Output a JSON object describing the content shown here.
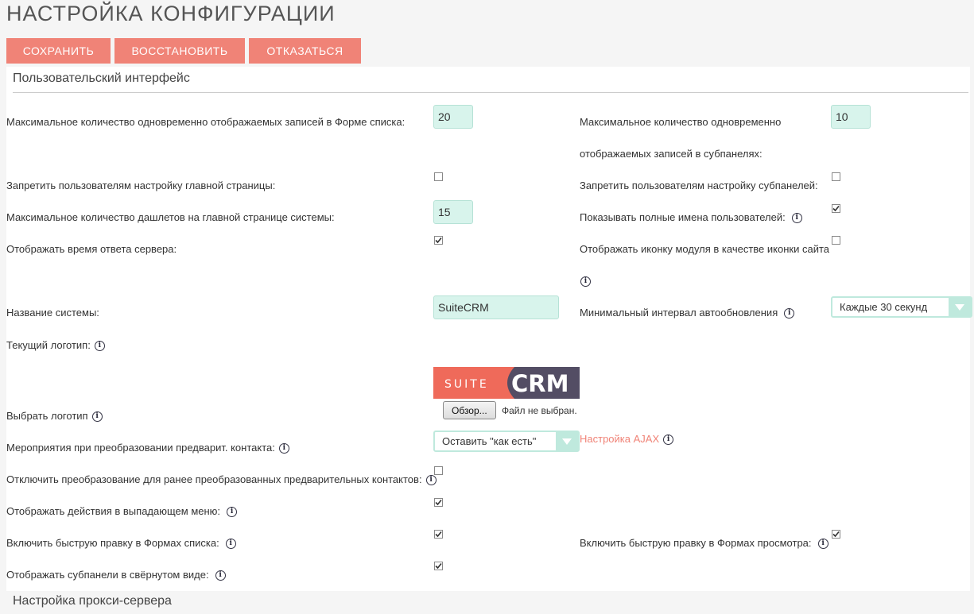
{
  "page": {
    "title": "НАСТРОЙКА КОНФИГУРАЦИИ"
  },
  "toolbar": {
    "save": "СОХРАНИТЬ",
    "restore": "ВОССТАНОВИТЬ",
    "cancel": "ОТКАЗАТЬСЯ"
  },
  "sections": {
    "ui": "Пользовательский интерфейс",
    "proxy": "Настройка прокси-сервера"
  },
  "fields": {
    "list_max": {
      "label": "Максимальное количество одновременно отображаемых записей в Форме списка:",
      "value": "20"
    },
    "subpanel_max": {
      "label1": "Максимальное количество одновременно",
      "label2": "отображаемых записей в субпанелях:",
      "value": "10"
    },
    "lock_home": {
      "label": "Запретить пользователям настройку главной страницы:",
      "checked": false
    },
    "lock_subpanels": {
      "label": "Запретить пользователям настройку субпанелей:",
      "checked": false
    },
    "dashlets_max": {
      "label": "Максимальное количество дашлетов на главной странице системы:",
      "value": "15"
    },
    "full_names": {
      "label": "Показывать полные имена пользователей:",
      "checked": true
    },
    "server_time": {
      "label": "Отображать время ответа сервера:",
      "checked": true
    },
    "module_icon": {
      "label": "Отображать иконку модуля в качестве иконки сайта",
      "checked": false
    },
    "system_name": {
      "label": "Название системы:",
      "value": "SuiteCRM"
    },
    "autorefresh": {
      "label": "Минимальный интервал автообновления",
      "value": "Каждые 30 секунд"
    },
    "current_logo": {
      "label": "Текущий логотип:",
      "logo_left": "SUITE",
      "logo_right": "CRM"
    },
    "choose_logo": {
      "label": "Выбрать логотип",
      "button": "Обзор...",
      "status": "Файл не выбран."
    },
    "lead_activities": {
      "label": "Мероприятия при преобразовании предварит. контакта:",
      "value": "Оставить \"как есть\""
    },
    "ajax_link": "Настройка AJAX",
    "disable_convert": {
      "label": "Отключить преобразование для ранее преобразованных предварительных контактов:",
      "checked": false
    },
    "actions_dropdown": {
      "label": "Отображать действия в выпадающем меню:",
      "checked": true
    },
    "quickedit_list": {
      "label": "Включить быструю правку в Формах списка:",
      "checked": true
    },
    "quickedit_detail": {
      "label": "Включить быструю правку в Формах просмотра:",
      "checked": true
    },
    "collapsed_subpanels": {
      "label": "Отображать субпанели в свёрнутом виде:",
      "checked": true
    }
  },
  "colors": {
    "accent": "#f08377",
    "input_bg": "#d8f4ec",
    "logo_red": "#ef6a5a",
    "logo_dark": "#534d64"
  }
}
